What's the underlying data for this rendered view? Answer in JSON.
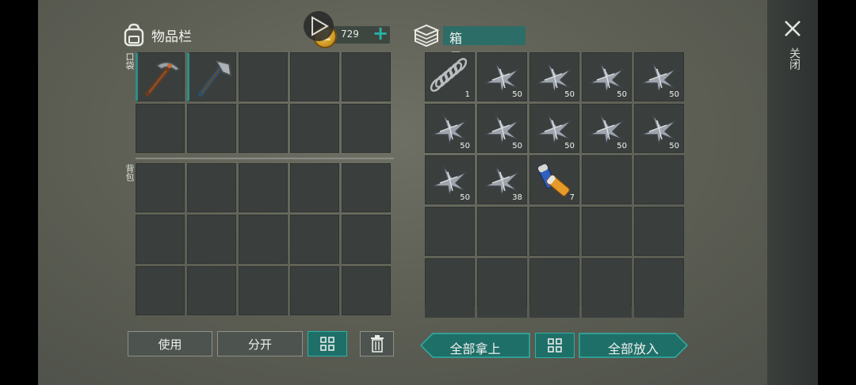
{
  "inventory": {
    "title": "物品栏",
    "gold_amount": "729",
    "pocket_label": "口袋",
    "backpack_label": "背包",
    "pocket_slots": [
      {
        "item": "pickaxe-icon",
        "qty": ""
      },
      {
        "item": "hatchet-icon",
        "qty": ""
      },
      {
        "item": "",
        "qty": ""
      },
      {
        "item": "",
        "qty": ""
      },
      {
        "item": "",
        "qty": ""
      },
      {
        "item": "",
        "qty": ""
      },
      {
        "item": "",
        "qty": ""
      },
      {
        "item": "",
        "qty": ""
      },
      {
        "item": "",
        "qty": ""
      },
      {
        "item": "",
        "qty": ""
      }
    ],
    "buttons": {
      "use": "使用",
      "split": "分开"
    }
  },
  "box": {
    "title": "箱子",
    "slots": [
      {
        "item": "spring-icon",
        "qty": "1"
      },
      {
        "item": "metal-scrap-icon",
        "qty": "50"
      },
      {
        "item": "metal-scrap-icon",
        "qty": "50"
      },
      {
        "item": "metal-scrap-icon",
        "qty": "50"
      },
      {
        "item": "metal-scrap-icon",
        "qty": "50"
      },
      {
        "item": "metal-scrap-icon",
        "qty": "50"
      },
      {
        "item": "metal-scrap-icon",
        "qty": "50"
      },
      {
        "item": "metal-scrap-icon",
        "qty": "50"
      },
      {
        "item": "metal-scrap-icon",
        "qty": "50"
      },
      {
        "item": "metal-scrap-icon",
        "qty": "50"
      },
      {
        "item": "metal-scrap-icon",
        "qty": "50"
      },
      {
        "item": "metal-scrap-icon",
        "qty": "38"
      },
      {
        "item": "battery-icon",
        "qty": "7"
      }
    ],
    "buttons": {
      "take_all": "全部拿上",
      "put_all": "全部放入"
    }
  },
  "close_label": "关闭",
  "colors": {
    "accent": "#2fb0a4",
    "slot": "#3a3f3d",
    "teal_dark": "#1f6f69"
  }
}
